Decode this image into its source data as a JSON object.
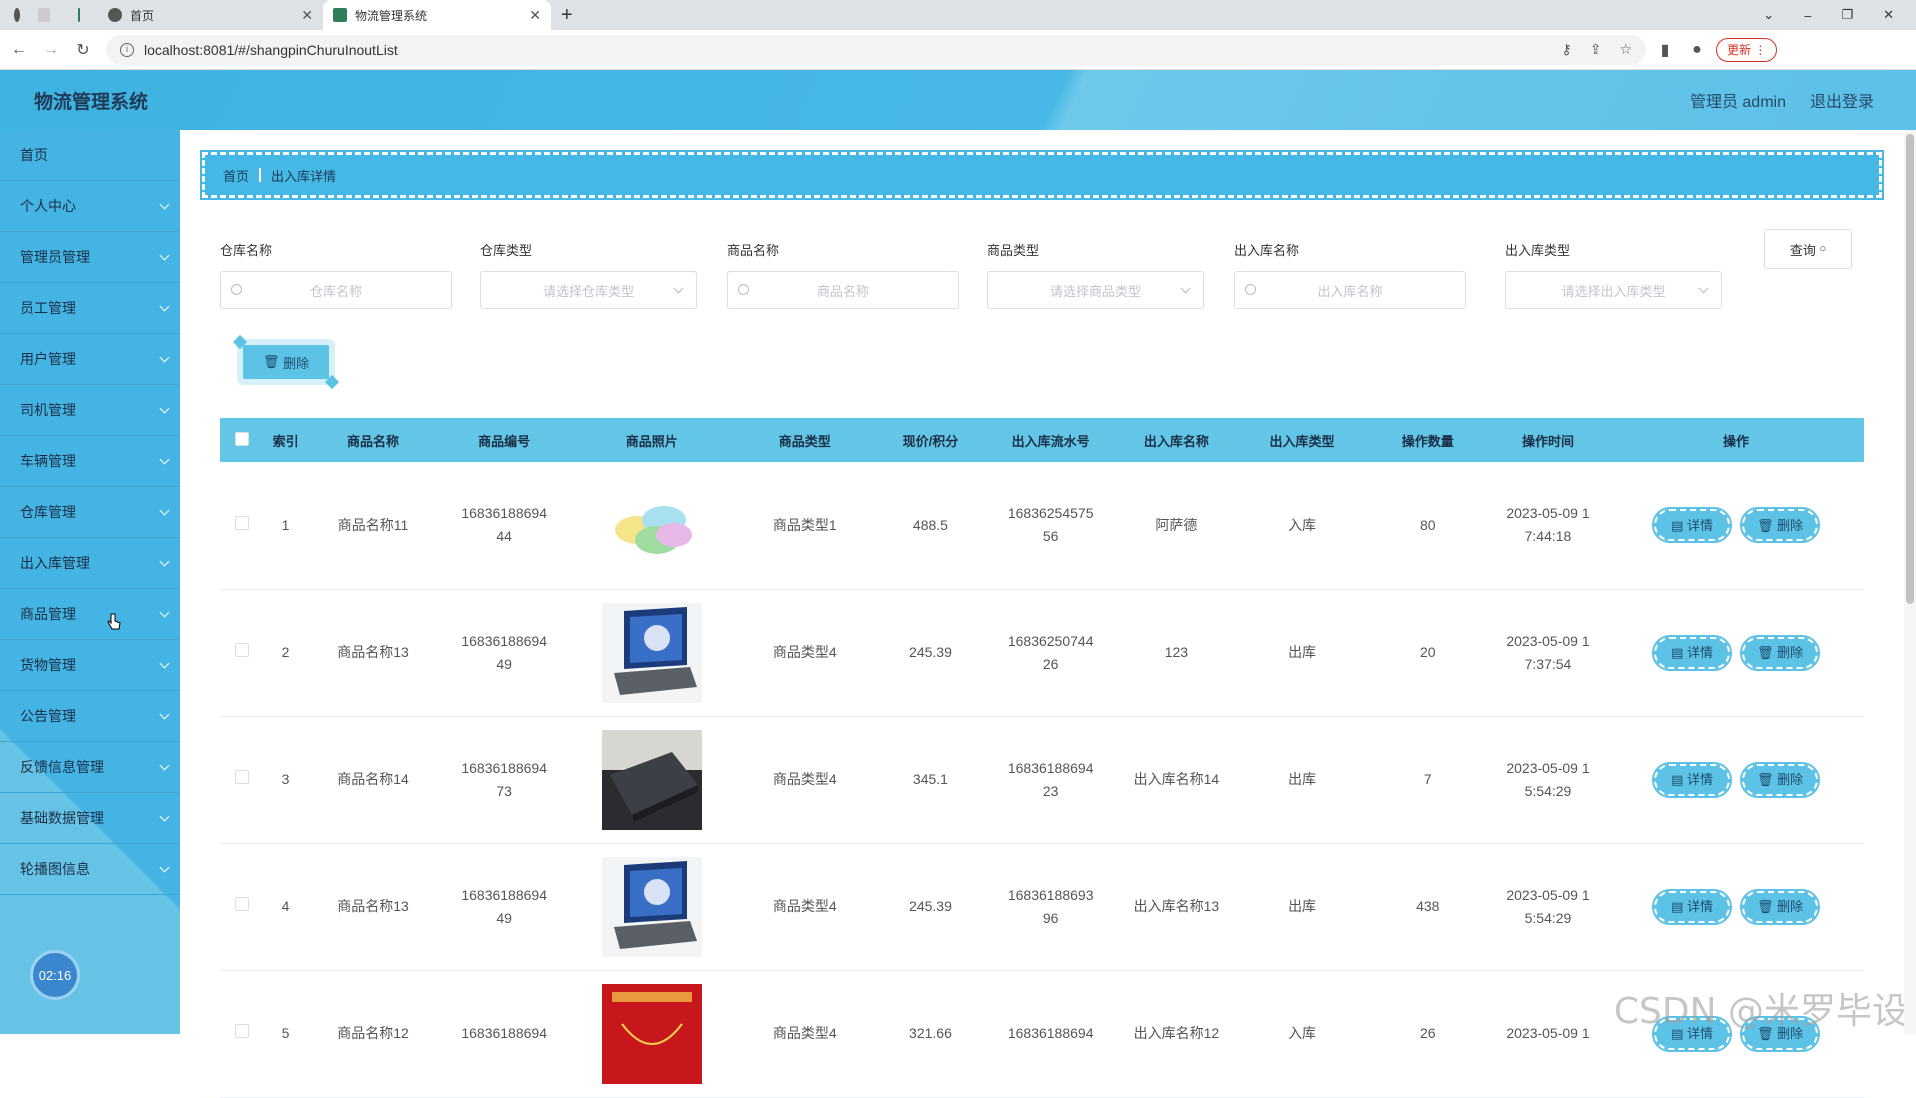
{
  "browser": {
    "tabs": [
      {
        "label": "首页"
      },
      {
        "label": "物流管理系统"
      }
    ],
    "url": "localhost:8081/#/shangpinChuruInoutList",
    "update_label": "更新"
  },
  "header": {
    "title": "物流管理系统",
    "user": "管理员 admin",
    "logout": "退出登录"
  },
  "sidebar": {
    "items": [
      {
        "label": "首页",
        "has_children": false
      },
      {
        "label": "个人中心",
        "has_children": true
      },
      {
        "label": "管理员管理",
        "has_children": true
      },
      {
        "label": "员工管理",
        "has_children": true
      },
      {
        "label": "用户管理",
        "has_children": true
      },
      {
        "label": "司机管理",
        "has_children": true
      },
      {
        "label": "车辆管理",
        "has_children": true
      },
      {
        "label": "仓库管理",
        "has_children": true
      },
      {
        "label": "出入库管理",
        "has_children": true
      },
      {
        "label": "商品管理",
        "has_children": true
      },
      {
        "label": "货物管理",
        "has_children": true
      },
      {
        "label": "公告管理",
        "has_children": true
      },
      {
        "label": "反馈信息管理",
        "has_children": true
      },
      {
        "label": "基础数据管理",
        "has_children": true
      },
      {
        "label": "轮播图信息",
        "has_children": true
      }
    ],
    "clock": "02:16"
  },
  "breadcrumb": {
    "home": "首页",
    "current": "出入库详情"
  },
  "filters": {
    "warehouse_name": {
      "label": "仓库名称",
      "placeholder": "仓库名称"
    },
    "warehouse_type": {
      "label": "仓库类型",
      "placeholder": "请选择仓库类型"
    },
    "product_name": {
      "label": "商品名称",
      "placeholder": "商品名称"
    },
    "product_type": {
      "label": "商品类型",
      "placeholder": "请选择商品类型"
    },
    "inout_name": {
      "label": "出入库名称",
      "placeholder": "出入库名称"
    },
    "inout_type": {
      "label": "出入库类型",
      "placeholder": "请选择出入库类型"
    },
    "query_label": "查询"
  },
  "actions": {
    "batch_delete": "删除",
    "detail": "详情",
    "delete": "删除"
  },
  "table": {
    "headers": [
      "索引",
      "商品名称",
      "商品编号",
      "商品照片",
      "商品类型",
      "现价/积分",
      "出入库流水号",
      "出入库名称",
      "出入库类型",
      "操作数量",
      "操作时间",
      "操作"
    ],
    "rows": [
      {
        "index": "1",
        "name": "商品名称11",
        "code1": "16836188694",
        "code2": "44",
        "photo": "bowls",
        "type": "商品类型1",
        "price": "488.5",
        "serial1": "16836254575",
        "serial2": "56",
        "inout_name": "阿萨德",
        "inout_type": "入库",
        "qty": "80",
        "time1": "2023-05-09 1",
        "time2": "7:44:18"
      },
      {
        "index": "2",
        "name": "商品名称13",
        "code1": "16836188694",
        "code2": "49",
        "photo": "laptop",
        "type": "商品类型4",
        "price": "245.39",
        "serial1": "16836250744",
        "serial2": "26",
        "inout_name": "123",
        "inout_type": "出库",
        "qty": "20",
        "time1": "2023-05-09 1",
        "time2": "7:37:54"
      },
      {
        "index": "3",
        "name": "商品名称14",
        "code1": "16836188694",
        "code2": "73",
        "photo": "dark-laptop",
        "type": "商品类型4",
        "price": "345.1",
        "serial1": "16836188694",
        "serial2": "23",
        "inout_name": "出入库名称14",
        "inout_type": "出库",
        "qty": "7",
        "time1": "2023-05-09 1",
        "time2": "5:54:29"
      },
      {
        "index": "4",
        "name": "商品名称13",
        "code1": "16836188694",
        "code2": "49",
        "photo": "laptop",
        "type": "商品类型4",
        "price": "245.39",
        "serial1": "16836188693",
        "serial2": "96",
        "inout_name": "出入库名称13",
        "inout_type": "出库",
        "qty": "438",
        "time1": "2023-05-09 1",
        "time2": "5:54:29"
      },
      {
        "index": "5",
        "name": "商品名称12",
        "code1": "16836188694",
        "code2": "",
        "photo": "red-poster",
        "type": "商品类型4",
        "price": "321.66",
        "serial1": "16836188694",
        "serial2": "",
        "inout_name": "出入库名称12",
        "inout_type": "入库",
        "qty": "26",
        "time1": "2023-05-09 1",
        "time2": ""
      }
    ]
  },
  "watermark": "CSDN @米罗毕设"
}
